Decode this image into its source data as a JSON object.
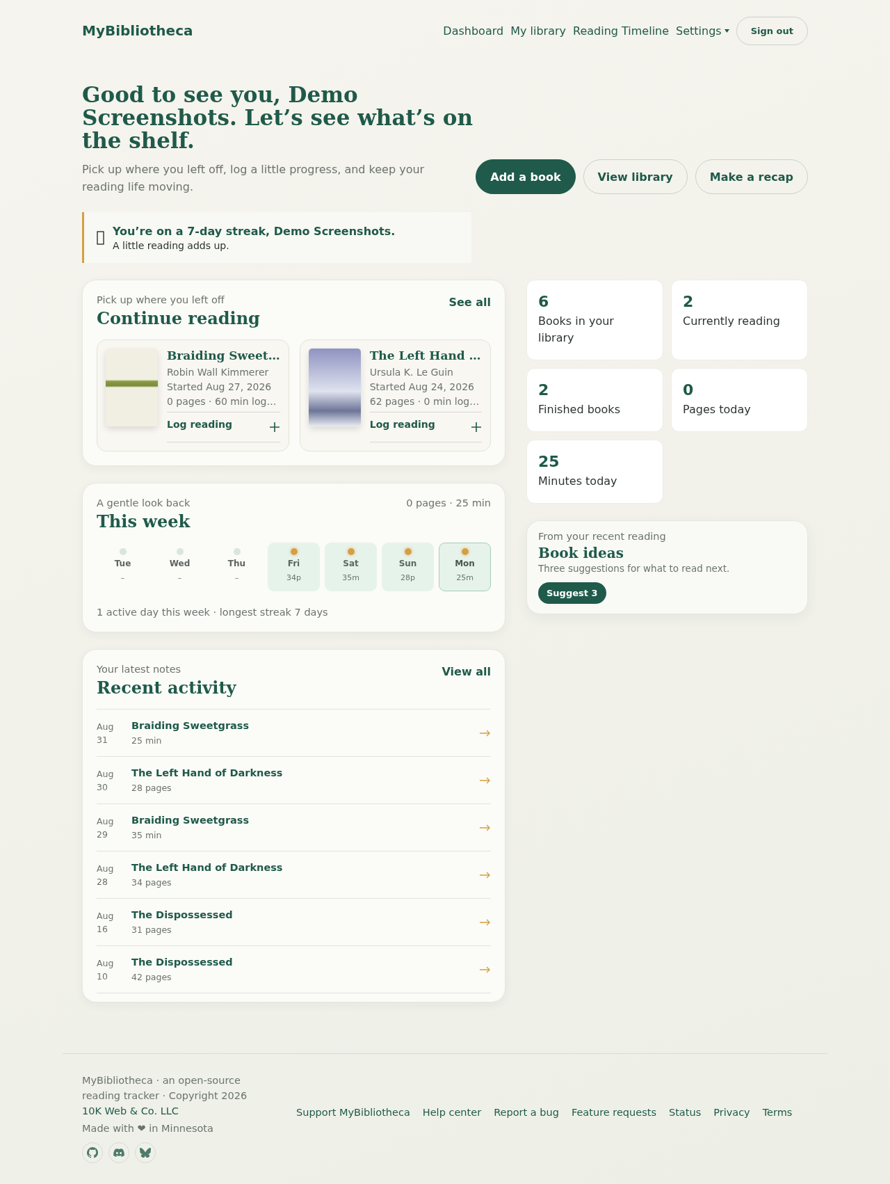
{
  "brand": "MyBibliotheca",
  "nav": {
    "links": [
      "Dashboard",
      "My library",
      "Reading Timeline"
    ],
    "settings": "Settings",
    "sign_out": "Sign out"
  },
  "hero": {
    "title": "Good to see you, Demo Screenshots. Let’s see what’s on the shelf.",
    "subtitle": "Pick up where you left off, log a little progress, and keep your reading life moving.",
    "actions": [
      {
        "label": "Add a book",
        "primary": true
      },
      {
        "label": "View library",
        "primary": false
      },
      {
        "label": "Make a recap",
        "primary": false
      }
    ]
  },
  "streak": {
    "title": "You’re on a 7-day streak, Demo Screenshots.",
    "subtitle": "A little reading adds up."
  },
  "continue_reading": {
    "eyebrow": "Pick up where you left off",
    "title": "Continue reading",
    "link": "See all",
    "books": [
      {
        "title": "Braiding Sweet…",
        "author": "Robin Wall Kimmerer",
        "started": "Started Aug 27, 2026",
        "stats": "0 pages · 60 min log…",
        "action": "Log reading"
      },
      {
        "title": "The Left Hand …",
        "author": "Ursula K. Le Guin",
        "started": "Started Aug 24, 2026",
        "stats": "62 pages · 0 min log…",
        "action": "Log reading"
      }
    ]
  },
  "this_week": {
    "eyebrow": "A gentle look back",
    "title": "This week",
    "summary": "0 pages · 25 min",
    "days": [
      {
        "label": "Tue",
        "value": "–",
        "active": false,
        "today": false
      },
      {
        "label": "Wed",
        "value": "–",
        "active": false,
        "today": false
      },
      {
        "label": "Thu",
        "value": "–",
        "active": false,
        "today": false
      },
      {
        "label": "Fri",
        "value": "34p",
        "active": true,
        "today": false
      },
      {
        "label": "Sat",
        "value": "35m",
        "active": true,
        "today": false
      },
      {
        "label": "Sun",
        "value": "28p",
        "active": true,
        "today": false
      },
      {
        "label": "Mon",
        "value": "25m",
        "active": true,
        "today": true
      }
    ],
    "footnote": "1 active day this week · longest streak 7 days"
  },
  "recent_activity": {
    "eyebrow": "Your latest notes",
    "title": "Recent activity",
    "link": "View all",
    "items": [
      {
        "month": "Aug",
        "day": "31",
        "title": "Braiding Sweetgrass",
        "detail": "25 min"
      },
      {
        "month": "Aug",
        "day": "30",
        "title": "The Left Hand of Darkness",
        "detail": "28 pages"
      },
      {
        "month": "Aug",
        "day": "29",
        "title": "Braiding Sweetgrass",
        "detail": "35 min"
      },
      {
        "month": "Aug",
        "day": "28",
        "title": "The Left Hand of Darkness",
        "detail": "34 pages"
      },
      {
        "month": "Aug",
        "day": "16",
        "title": "The Dispossessed",
        "detail": "31 pages"
      },
      {
        "month": "Aug",
        "day": "10",
        "title": "The Dispossessed",
        "detail": "42 pages"
      }
    ]
  },
  "stats": [
    {
      "value": "6",
      "label": "Books in your library"
    },
    {
      "value": "2",
      "label": "Currently reading"
    },
    {
      "value": "2",
      "label": "Finished books"
    },
    {
      "value": "0",
      "label": "Pages today"
    },
    {
      "value": "25",
      "label": "Minutes today"
    }
  ],
  "book_ideas": {
    "eyebrow": "From your recent reading",
    "title": "Book ideas",
    "subtitle": "Three suggestions for what to read next.",
    "button": "Suggest 3"
  },
  "footer": {
    "about": "MyBibliotheca · an open-source reading tracker · Copyright 2026",
    "company": "10K Web & Co. LLC",
    "made_with": "Made with ❤ in Minnesota",
    "links": [
      "Support MyBibliotheca",
      "Help center",
      "Report a bug",
      "Feature requests",
      "Status",
      "Privacy",
      "Terms"
    ],
    "social": [
      {
        "kind": "github"
      },
      {
        "kind": "discord"
      },
      {
        "kind": "butterfly"
      }
    ]
  }
}
